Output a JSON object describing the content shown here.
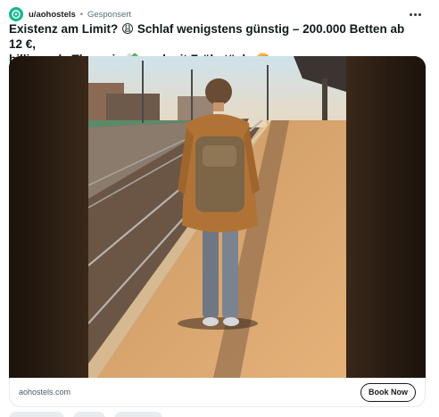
{
  "post": {
    "author": "u/aohostels",
    "separator": "•",
    "promoted_label": "Gesponsert",
    "title_line1": "Existenz am Limit? 😩 Schlaf wenigstens günstig – 200.000 Betten ab 12 €,",
    "title_line2": "billiger als Therapie 💸 und mit Frühstück. 🥐",
    "link_domain": "aohostels.com",
    "cta_label": "Book Now"
  },
  "icons": {
    "avatar": "hostel-logo-icon",
    "more": "more-options-icon"
  },
  "colors": {
    "brand": "#14b88f",
    "title": "#0f1a1c",
    "meta": "#576f76"
  }
}
